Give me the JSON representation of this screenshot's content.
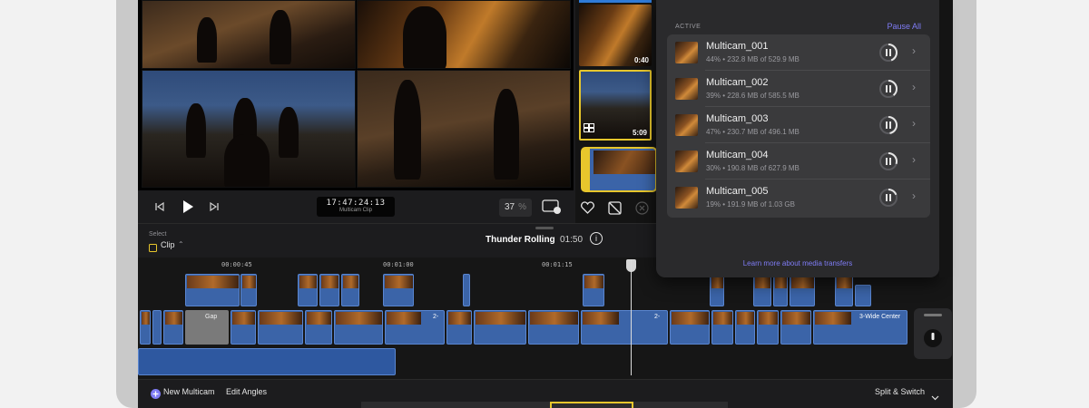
{
  "viewer": {
    "timecode": "17:47:24:13",
    "timecode_label": "Multicam Clip",
    "zoom_value": "37",
    "zoom_unit": "%"
  },
  "angles": [
    {
      "duration": "0:40"
    },
    {
      "duration": "5:09"
    }
  ],
  "timeline": {
    "select_label": "Select",
    "mode_value": "Clip",
    "project_title": "Thunder Rolling",
    "project_duration": "01:50",
    "ruler_ticks": [
      "00:00:45",
      "00:01:00",
      "00:01:15"
    ],
    "gap_label": "Gap",
    "clip_label_1": "2-",
    "clip_label_2": "2-",
    "clip_label_3": "3-Wide Center"
  },
  "footer": {
    "new_multicam": "New Multicam",
    "edit_angles": "Edit Angles",
    "split_switch": "Split & Switch"
  },
  "transfers": {
    "section_label": "ACTIVE",
    "pause_all": "Pause All",
    "items": [
      {
        "name": "Multicam_001",
        "details": "44% • 232.8 MB of 529.9 MB",
        "progress": 0.44
      },
      {
        "name": "Multicam_002",
        "details": "39% • 228.6 MB of 585.5 MB",
        "progress": 0.39
      },
      {
        "name": "Multicam_003",
        "details": "47% • 230.7 MB of 496.1 MB",
        "progress": 0.47
      },
      {
        "name": "Multicam_004",
        "details": "30% • 190.8 MB of 627.9 MB",
        "progress": 0.3
      },
      {
        "name": "Multicam_005",
        "details": "19% • 191.9 MB of 1.03 GB",
        "progress": 0.19
      }
    ],
    "learn_more": "Learn more about media transfers"
  },
  "colors": {
    "accent": "#7f7cf5",
    "clip_blue": "#3b64a8",
    "selection_yellow": "#e7c62c"
  }
}
